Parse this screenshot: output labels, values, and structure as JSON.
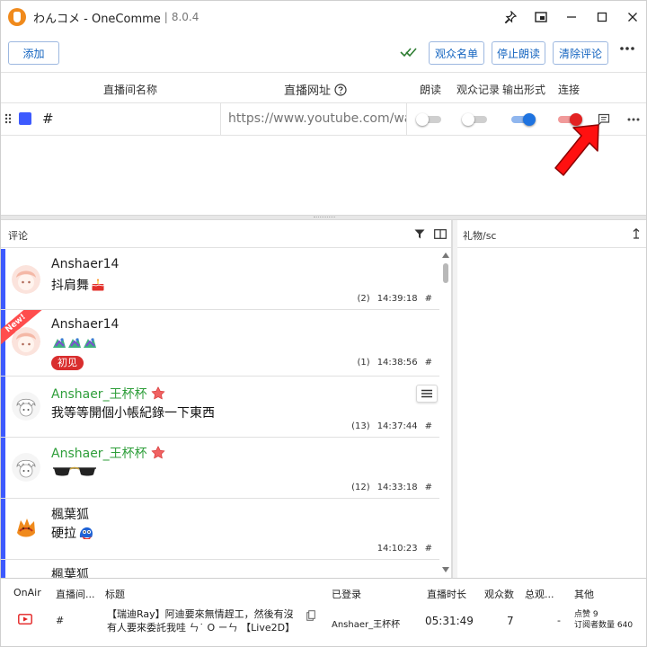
{
  "window": {
    "title": "わんコメ - OneComme",
    "separator": "|",
    "version": "8.0.4"
  },
  "toolbar": {
    "add_label": "添加",
    "viewer_list_label": "观众名单",
    "stop_reading_label": "停止朗读",
    "clear_comments_label": "清除评论"
  },
  "stream_table": {
    "headers": {
      "name": "直播间名称",
      "url": "直播网址",
      "read": "朗读",
      "record": "观众记录",
      "output": "输出形式",
      "connect": "连接"
    },
    "row": {
      "color": "#3d5afe",
      "name": "#",
      "url_placeholder": "https://www.youtube.com/watch?v=",
      "read": false,
      "record": false,
      "output": true,
      "connect": true
    }
  },
  "comments_panel": {
    "title": "评论",
    "comments": [
      {
        "author": "Anshaer14",
        "text": "抖肩舞",
        "emoji": "cake",
        "index": "(2)",
        "time": "14:39:18",
        "channel": "#"
      },
      {
        "author": "Anshaer14",
        "text": "",
        "emoji": "dragons",
        "badge": "初见",
        "new": "New!",
        "index": "(1)",
        "time": "14:38:56",
        "channel": "#"
      },
      {
        "author": "Anshaer_王杯杯",
        "text": "我等等開個小帳紀錄一下東西",
        "index": "(13)",
        "time": "14:37:44",
        "channel": "#",
        "moderator": true
      },
      {
        "author": "Anshaer_王杯杯",
        "text": "",
        "emoji": "sunglasses",
        "index": "(12)",
        "time": "14:33:18",
        "channel": "#",
        "moderator": true
      },
      {
        "author": "楓葉狐",
        "text": "硬拉",
        "emoji": "blue-blob",
        "index": "",
        "time": "14:10:23",
        "channel": "#"
      },
      {
        "author": "楓葉狐"
      }
    ]
  },
  "gifts_panel": {
    "title": "礼物/sc"
  },
  "bottom_table": {
    "headers": {
      "onair": "OnAir",
      "room": "直播间...",
      "title": "标题",
      "logged_in": "已登录",
      "duration": "直播时长",
      "viewers": "观众数",
      "total_viewers": "总观...",
      "other": "其他"
    },
    "row": {
      "room": "#",
      "title": "【瑞迪Ray】阿迪要來無情趕工，然後有沒有人要來委託我哇 ㄣ˙ O ㄧㄣ 【Live2D】",
      "logged_in": "Anshaer_王杯杯",
      "duration": "05:31:49",
      "viewers": "7",
      "total_viewers": "-",
      "likes": "点赞 9",
      "subscribers": "订阅者数量 640"
    }
  },
  "colors": {
    "accent_blue": "#1565c0",
    "live_red": "#e32222",
    "comment_bar": "#3d5afe",
    "moderator_green": "#2e9e3a"
  }
}
